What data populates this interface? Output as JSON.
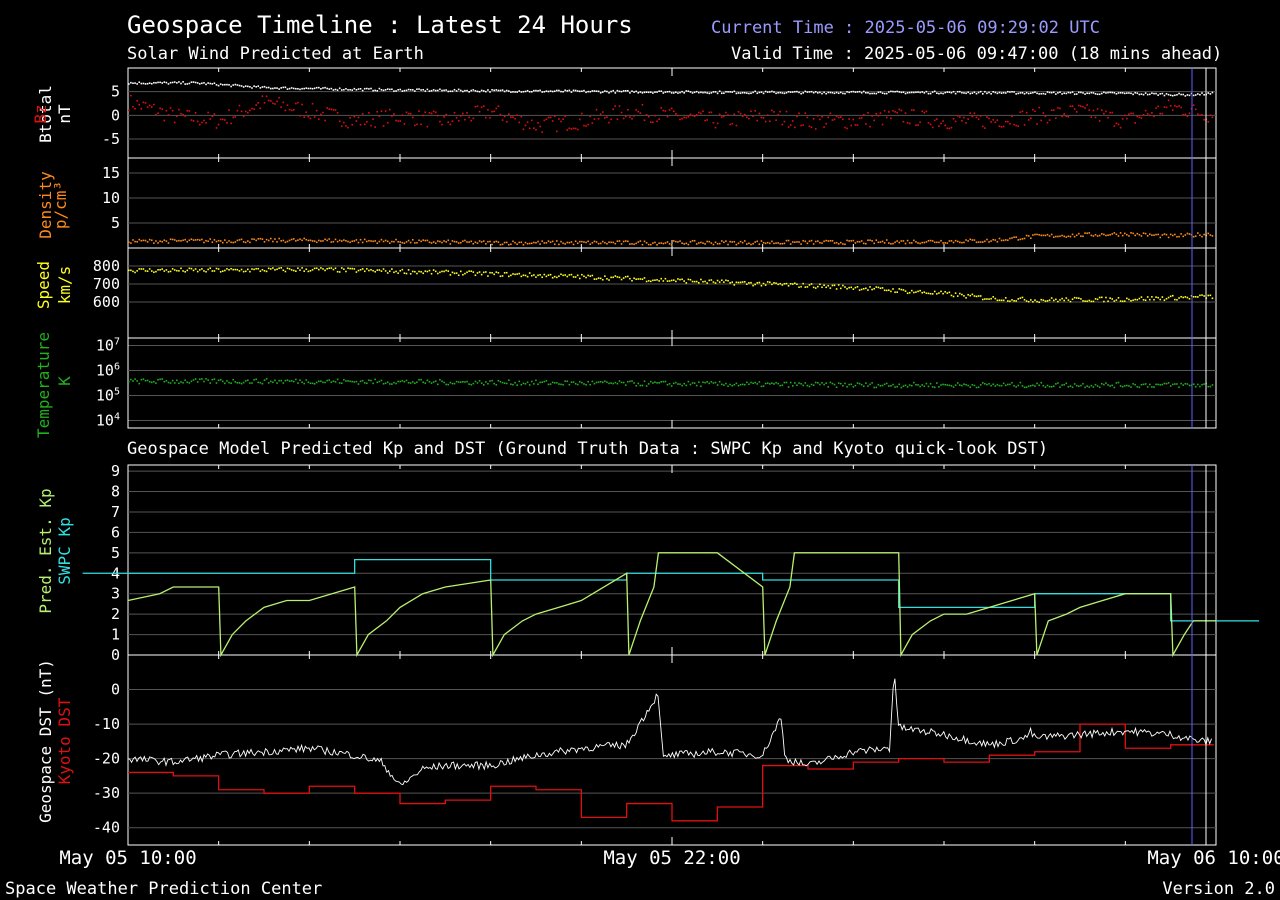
{
  "header": {
    "title": "Geospace Timeline : Latest 24 Hours",
    "subtitle": "Solar Wind Predicted at Earth",
    "current_time": "Current Time : 2025-05-06 09:29:02 UTC",
    "valid_time": "Valid Time : 2025-05-06 09:47:00 (18 mins ahead)"
  },
  "model_title": "Geospace Model Predicted Kp and DST (Ground Truth Data : SWPC Kp and Kyoto quick-look DST)",
  "footer": {
    "left": "Space Weather Prediction Center",
    "right": "Version 2.0"
  },
  "x_axis": {
    "ticks": [
      "May 05 10:00",
      "May 05 22:00",
      "May 06 10:00"
    ]
  },
  "colors": {
    "bz": "#e01010",
    "bt": "#ffffff",
    "density": "#ff8a1a",
    "speed": "#ffff20",
    "temp": "#20b020",
    "pred_kp": "#b8f070",
    "swpc_kp": "#30e0e0",
    "geo_dst": "#ffffff",
    "kyoto_dst": "#e01010",
    "now_line": "#6060ff"
  },
  "chart_data": [
    {
      "type": "scatter",
      "ylabels": [
        "Btotal",
        "Bz",
        "nT"
      ],
      "ylim": [
        -9,
        10
      ],
      "yticks": [
        "5",
        "0",
        "-5"
      ],
      "series": [
        {
          "name": "Btotal",
          "x": [
            0,
            1.5,
            3,
            6,
            10,
            14,
            18,
            22,
            23.3,
            24
          ],
          "y": [
            7,
            7,
            6,
            5.5,
            5.2,
            5,
            5,
            4.8,
            4.5,
            4.8
          ]
        },
        {
          "name": "Bz",
          "x": [
            0,
            1,
            2,
            3,
            4,
            5,
            6,
            7,
            8,
            9,
            10,
            11,
            12,
            13,
            14,
            15,
            16,
            17,
            18,
            19,
            20,
            21,
            22,
            23,
            24
          ],
          "y": [
            3,
            0,
            -1,
            3,
            1,
            -1,
            0,
            -1,
            1,
            -2,
            -1,
            1,
            0,
            -1,
            0,
            -1,
            -1,
            0,
            -1,
            -1,
            0,
            1,
            -1,
            2,
            0
          ]
        }
      ]
    },
    {
      "type": "scatter",
      "ylabels": [
        "Density",
        "p/cm³"
      ],
      "ylim": [
        0,
        18
      ],
      "yticks": [
        "15",
        "10",
        "5"
      ],
      "series": [
        {
          "name": "Density",
          "x": [
            0,
            4,
            8,
            12,
            16,
            19,
            20,
            22,
            23,
            24
          ],
          "y": [
            1.5,
            1.7,
            1.2,
            1.2,
            1.3,
            1.6,
            2.5,
            3,
            2.5,
            3
          ]
        }
      ]
    },
    {
      "type": "scatter",
      "ylabels": [
        "Speed",
        "km/s"
      ],
      "ylim": [
        400,
        900
      ],
      "yticks": [
        "800",
        "700",
        "600"
      ],
      "series": [
        {
          "name": "Speed",
          "x": [
            0,
            2,
            4,
            6,
            8,
            10,
            12,
            14,
            16,
            18,
            19,
            20,
            22,
            24
          ],
          "y": [
            780,
            780,
            785,
            775,
            760,
            745,
            725,
            705,
            685,
            650,
            625,
            615,
            620,
            635
          ]
        }
      ]
    },
    {
      "type": "scatter",
      "ylabels": [
        "Temperature",
        "K"
      ],
      "ylim": [
        3.7,
        7.3
      ],
      "log": true,
      "yticks": [
        "10^7",
        "10^6",
        "10^5",
        "10^4"
      ],
      "series": [
        {
          "name": "Temperature",
          "x": [
            0,
            4,
            8,
            12,
            16,
            20,
            24
          ],
          "y_log10": [
            5.6,
            5.6,
            5.55,
            5.5,
            5.45,
            5.45,
            5.45
          ]
        }
      ]
    },
    {
      "type": "line",
      "ylabels": [
        "Pred. Est. Kp",
        "SWPC Kp"
      ],
      "ylim": [
        0,
        9.3
      ],
      "yticks": [
        "9",
        "8",
        "7",
        "6",
        "5",
        "4",
        "3",
        "2",
        "1",
        "0"
      ],
      "series": [
        {
          "name": "SWPC Kp",
          "step": [
            [
              -1,
              4
            ],
            [
              5,
              4.67
            ],
            [
              8,
              3.67
            ],
            [
              11,
              4
            ],
            [
              14,
              3.67
            ],
            [
              17,
              2.33
            ],
            [
              20,
              3
            ],
            [
              23,
              1.67
            ],
            [
              24,
              1.67
            ]
          ]
        },
        {
          "name": "Pred. Est. Kp",
          "x": [
            0,
            0.7,
            1,
            2,
            2.05,
            2.3,
            2.6,
            3,
            3.5,
            4,
            5,
            5.05,
            5.3,
            5.7,
            6,
            6.5,
            7,
            8,
            8.05,
            8.3,
            8.7,
            9,
            9.5,
            10,
            11,
            11.05,
            11.3,
            11.6,
            11.7,
            13,
            14,
            14.05,
            14.3,
            14.6,
            14.7,
            17,
            17.05,
            17.3,
            17.7,
            18,
            18.5,
            19,
            20,
            20.05,
            20.3,
            20.7,
            21,
            21.5,
            22,
            23,
            23.05,
            23.3,
            23.5,
            24
          ],
          "y": [
            2.67,
            3,
            3.33,
            3.33,
            0,
            1,
            1.67,
            2.33,
            2.67,
            2.67,
            3.33,
            0,
            1,
            1.67,
            2.33,
            3,
            3.33,
            3.67,
            0,
            1,
            1.67,
            2,
            2.33,
            2.67,
            4,
            0,
            1.67,
            3.33,
            5,
            5,
            3.33,
            0,
            1.67,
            3.33,
            5,
            5,
            0,
            1,
            1.67,
            2,
            2,
            2.33,
            3,
            0,
            1.67,
            2,
            2.33,
            2.67,
            3,
            3,
            0,
            1,
            1.67,
            1.67
          ]
        }
      ]
    },
    {
      "type": "line",
      "ylabels": [
        "Geospace DST (nT)",
        "Kyoto DST"
      ],
      "ylim": [
        -45,
        10
      ],
      "yticks": [
        "0",
        "-10",
        "-20",
        "-30",
        "-40"
      ],
      "series": [
        {
          "name": "Kyoto DST",
          "step": [
            [
              0,
              -24
            ],
            [
              1,
              -25
            ],
            [
              2,
              -29
            ],
            [
              3,
              -30
            ],
            [
              4,
              -28
            ],
            [
              5,
              -30
            ],
            [
              6,
              -33
            ],
            [
              7,
              -32
            ],
            [
              8,
              -28
            ],
            [
              9,
              -29
            ],
            [
              10,
              -37
            ],
            [
              11,
              -33
            ],
            [
              12,
              -38
            ],
            [
              13,
              -34
            ],
            [
              14,
              -22
            ],
            [
              15,
              -23
            ],
            [
              16,
              -21
            ],
            [
              17,
              -20
            ],
            [
              18,
              -21
            ],
            [
              19,
              -19
            ],
            [
              20,
              -18
            ],
            [
              21,
              -10
            ],
            [
              22,
              -17
            ],
            [
              23,
              -16
            ]
          ]
        },
        {
          "name": "Geospace DST",
          "x": [
            0,
            1,
            2,
            3,
            4,
            5,
            5.6,
            6,
            6.3,
            6.5,
            7,
            8,
            9,
            10,
            11,
            11.7,
            11.8,
            12,
            13,
            14,
            14.4,
            14.5,
            15,
            16,
            16.8,
            16.9,
            17,
            18,
            19,
            19.8,
            19.9,
            20,
            21,
            22,
            23,
            23.7,
            24
          ],
          "y": [
            -20,
            -21,
            -19,
            -18,
            -17,
            -19,
            -21,
            -28,
            -25,
            -23,
            -22,
            -22,
            -19,
            -17,
            -16,
            -1,
            -20,
            -19,
            -18,
            -19,
            -8,
            -20,
            -22,
            -18,
            -17,
            6,
            -11,
            -13,
            -16,
            -14,
            -12,
            -14,
            -13,
            -12,
            -13,
            -15,
            -15
          ]
        }
      ]
    }
  ]
}
